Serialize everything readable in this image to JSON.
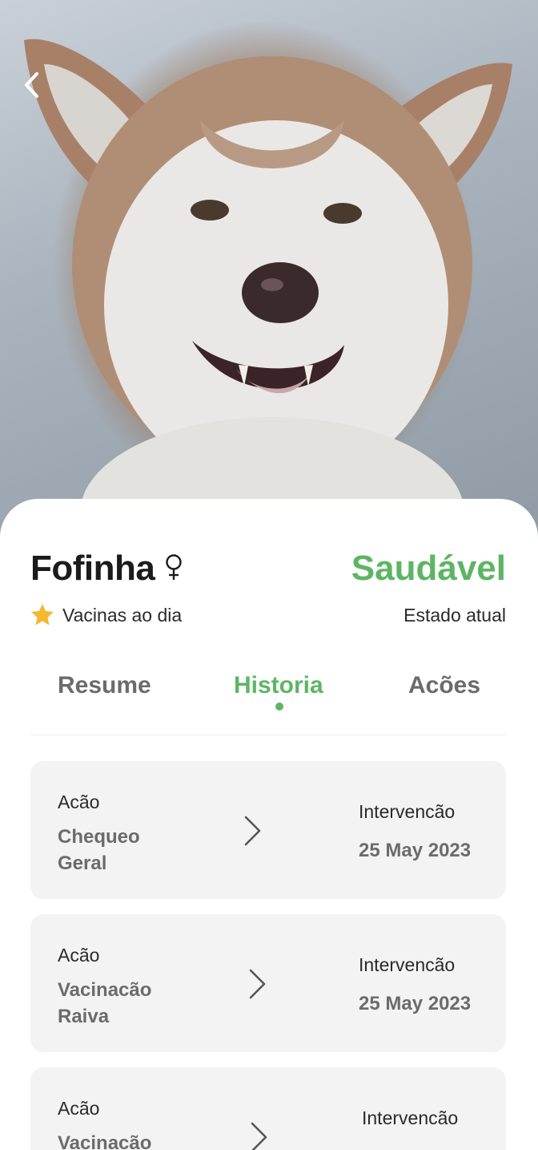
{
  "hero": {
    "image_alt": "dog-photo"
  },
  "pet": {
    "name": "Fofinha",
    "status": "Saudável",
    "vaccines": "Vacinas ao dia",
    "state_label": "Estado atual"
  },
  "tabs": [
    {
      "label": "Resume"
    },
    {
      "label": "Historia"
    },
    {
      "label": "Acões"
    }
  ],
  "active_tab": "Historia",
  "history": [
    {
      "action_label": "Acão",
      "action": "Chequeo Geral",
      "intervention_label": "Intervencão",
      "date": "25 May 2023"
    },
    {
      "action_label": "Acão",
      "action": "Vacinacão Raiva",
      "intervention_label": "Intervencão",
      "date": "25 May 2023"
    },
    {
      "action_label": "Acão",
      "action": "Vacinacão",
      "intervention_label": "Intervencão",
      "date": ""
    }
  ],
  "colors": {
    "accent": "#5db563",
    "card_bg": "#f3f3f3",
    "star": "#f5b82e"
  },
  "icons": [
    "chevron-left-icon",
    "female-icon",
    "star-icon",
    "chevron-right-icon"
  ]
}
